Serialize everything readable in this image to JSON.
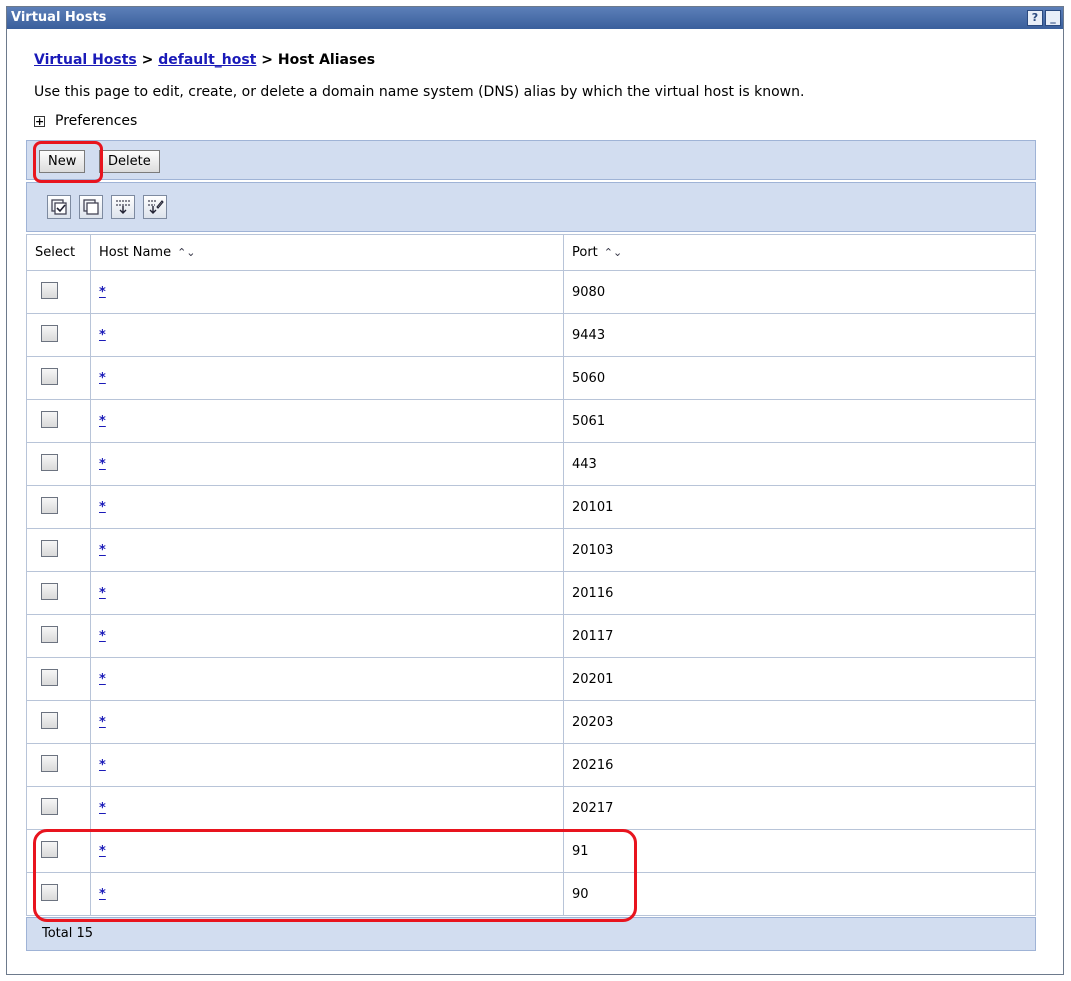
{
  "panel": {
    "title": "Virtual Hosts",
    "help": "?",
    "minimize": "_"
  },
  "breadcrumb": {
    "root": "Virtual Hosts",
    "sep1": " > ",
    "host": "default_host",
    "sep2": " > ",
    "current": "Host Aliases"
  },
  "description": "Use this page to edit, create, or delete a domain name system (DNS) alias by which the virtual host is known.",
  "preferences": {
    "toggle": "+",
    "label": "Preferences"
  },
  "toolbar": {
    "new_label": "New",
    "delete_label": "Delete"
  },
  "icons": [
    "select-all-icon",
    "deselect-all-icon",
    "show-filter-icon",
    "clear-filter-icon"
  ],
  "table": {
    "headers": {
      "select": "Select",
      "host": "Host Name",
      "port": "Port"
    },
    "rows": [
      {
        "host": "*",
        "port": "9080"
      },
      {
        "host": "*",
        "port": "9443"
      },
      {
        "host": "*",
        "port": "5060"
      },
      {
        "host": "*",
        "port": "5061"
      },
      {
        "host": "*",
        "port": "443"
      },
      {
        "host": "*",
        "port": "20101"
      },
      {
        "host": "*",
        "port": "20103"
      },
      {
        "host": "*",
        "port": "20116"
      },
      {
        "host": "*",
        "port": "20117"
      },
      {
        "host": "*",
        "port": "20201"
      },
      {
        "host": "*",
        "port": "20203"
      },
      {
        "host": "*",
        "port": "20216"
      },
      {
        "host": "*",
        "port": "20217"
      },
      {
        "host": "*",
        "port": "91"
      },
      {
        "host": "*",
        "port": "90"
      }
    ]
  },
  "footer": {
    "total": "Total 15"
  },
  "colors": {
    "highlight": "#e8141e",
    "bar": "#d2ddf0",
    "link": "#1a1ab8"
  }
}
